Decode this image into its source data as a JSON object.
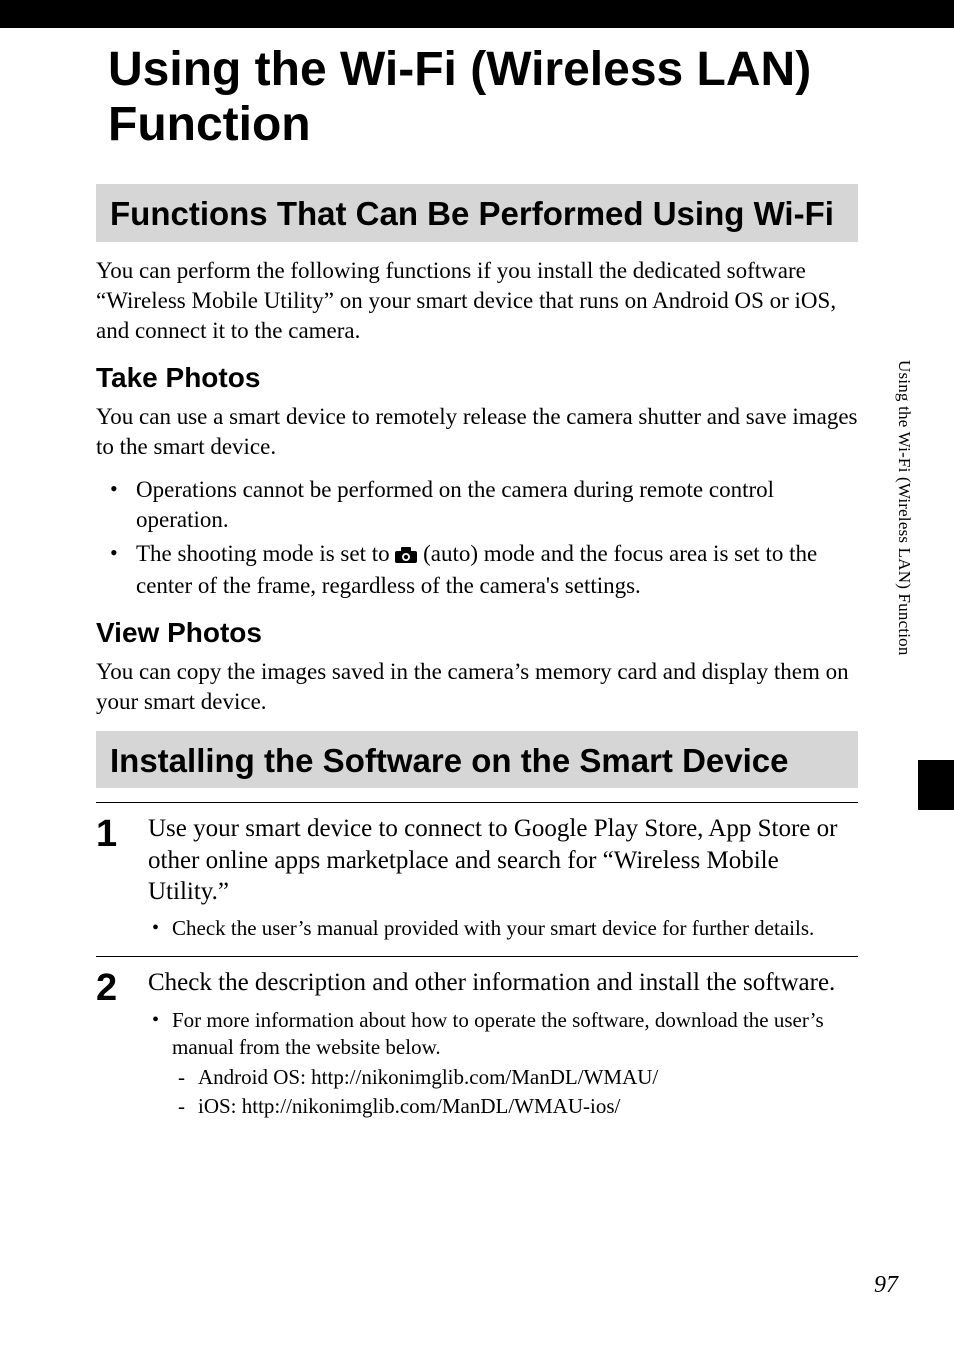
{
  "pageTitle": "Using the Wi-Fi (Wireless LAN) Function",
  "section1": {
    "header": "Functions That Can Be Performed Using Wi-Fi",
    "intro": "You can perform the following functions if you install the dedicated software “Wireless Mobile Utility” on your smart device that runs on Android OS or iOS, and connect it to the camera.",
    "sub1": {
      "title": "Take Photos",
      "text": "You can use a smart device to remotely release the camera shutter and save images to the smart device.",
      "bullets": {
        "b1": "Operations cannot be performed on the camera during remote control operation.",
        "b2a": "The shooting mode is set to ",
        "b2b": " (auto) mode and the focus area is set to the center of the frame, regardless of the camera's settings."
      }
    },
    "sub2": {
      "title": "View Photos",
      "text": "You can copy the images saved in the camera’s memory card and display them on your smart device."
    }
  },
  "section2": {
    "header": "Installing the Software on the Smart Device",
    "steps": [
      {
        "num": "1",
        "text": "Use your smart device to connect to Google Play Store, App Store or other online apps marketplace and search for “Wireless Mobile Utility.”",
        "subBullet": "Check the user’s manual provided with your smart device for further details."
      },
      {
        "num": "2",
        "text": "Check the description and other information and install the software.",
        "subBullet": "For more information about how to operate the software, download the user’s manual from the website below.",
        "dashes": [
          "Android OS: http://nikonimglib.com/ManDL/WMAU/",
          "iOS: http://nikonimglib.com/ManDL/WMAU-ios/"
        ]
      }
    ]
  },
  "sideTab": "Using the Wi-Fi (Wireless LAN) Function",
  "pageNumber": "97"
}
